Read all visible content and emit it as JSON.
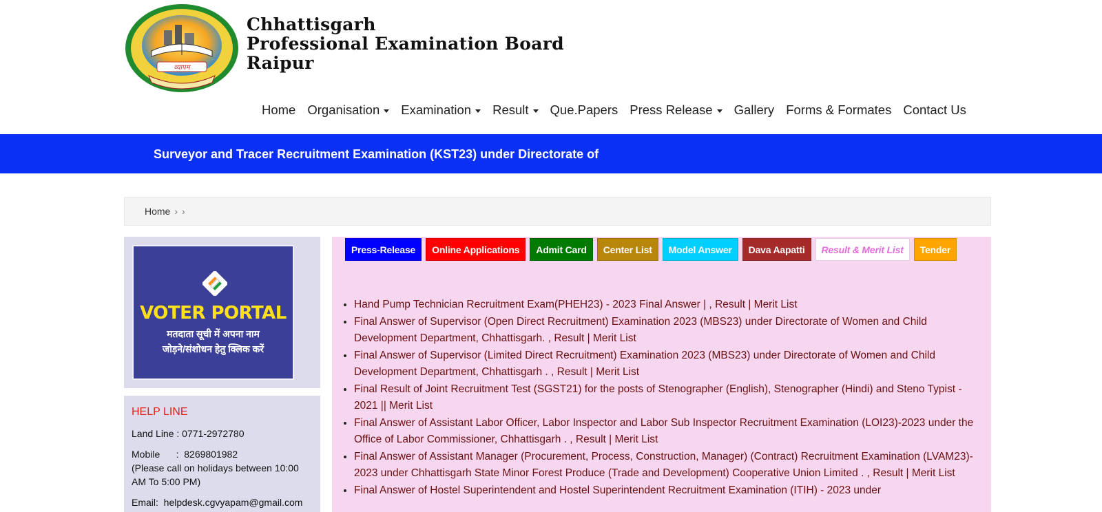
{
  "header": {
    "title_lines": [
      "Chhattisgarh",
      "Professional Examination Board",
      "Raipur"
    ],
    "logo_text": "व्यापम"
  },
  "nav": {
    "items": [
      {
        "label": "Home",
        "dropdown": false
      },
      {
        "label": "Organisation",
        "dropdown": true
      },
      {
        "label": "Examination",
        "dropdown": true
      },
      {
        "label": "Result",
        "dropdown": true
      },
      {
        "label": "Que.Papers",
        "dropdown": false
      },
      {
        "label": "Press Release",
        "dropdown": true
      },
      {
        "label": "Gallery",
        "dropdown": false
      },
      {
        "label": "Forms & Formates",
        "dropdown": false
      },
      {
        "label": "Contact Us",
        "dropdown": false
      }
    ]
  },
  "marquee": {
    "text": "Surveyor and Tracer Recruitment Examination (KST23) under Directorate of"
  },
  "breadcrumb": {
    "home": "Home"
  },
  "voter_portal": {
    "title": "VOTER PORTAL",
    "line1": "मतदाता सूची में अपना नाम",
    "line2": "जोड़ने/संशोधन हेतु क्लिक करें"
  },
  "helpline": {
    "title": "HELP LINE",
    "landline": "Land Line : 0771-2972780",
    "mobile": "Mobile      :  8269801982",
    "mobile_note": "(Please call on holidays between 10:00 AM To 5:00 PM)",
    "email": "Email:  helpdesk.cgvyapam@gmail.com"
  },
  "tabs": [
    {
      "label": "Press-Release",
      "color": "#0000ff"
    },
    {
      "label": "Online Applications",
      "color": "#ff0000"
    },
    {
      "label": "Admit Card",
      "color": "#007a00"
    },
    {
      "label": "Center List",
      "color": "#b8860b"
    },
    {
      "label": "Model Answer",
      "color": "#00cfff"
    },
    {
      "label": "Dava Aapatti",
      "color": "#a52a2a"
    },
    {
      "label": "Result & Merit List",
      "color": "#ffffff"
    },
    {
      "label": "Tender",
      "color": "#ffa500"
    }
  ],
  "results": [
    "Hand Pump Technician Recruitment Exam(PHEH23) - 2023  Final Answer | , Result  | Merit List",
    "Final Answer of Supervisor (Open Direct Recruitment) Examination 2023 (MBS23) under Directorate of Women and Child Development Department, Chhattisgarh.  , Result  | Merit List",
    "Final Answer of Supervisor (Limited Direct Recruitment) Examination 2023 (MBS23) under Directorate of Women and Child Development Department, Chhattisgarh . , Result  | Merit List",
    "Final Result of Joint Recruitment Test (SGST21) for the posts of Stenographer (English), Stenographer (Hindi) and Steno Typist - 2021   || Merit List",
    "Final Answer of Assistant Labor Officer, Labor Inspector and Labor Sub Inspector Recruitment Examination (LOI23)-2023 under the Office of Labor Commissioner, Chhattisgarh  .  , Result  | Merit List",
    "Final Answer of Assistant Manager (Procurement, Process, Construction, Manager) (Contract) Recruitment Examination (LVAM23)- 2023 under Chhattisgarh State Minor Forest Produce (Trade and Development) Cooperative Union Limited .  , Result  | Merit List",
    "Final Answer of Hostel Superintendent and Hostel Superintendent Recruitment Examination (ITIH) - 2023 under"
  ]
}
